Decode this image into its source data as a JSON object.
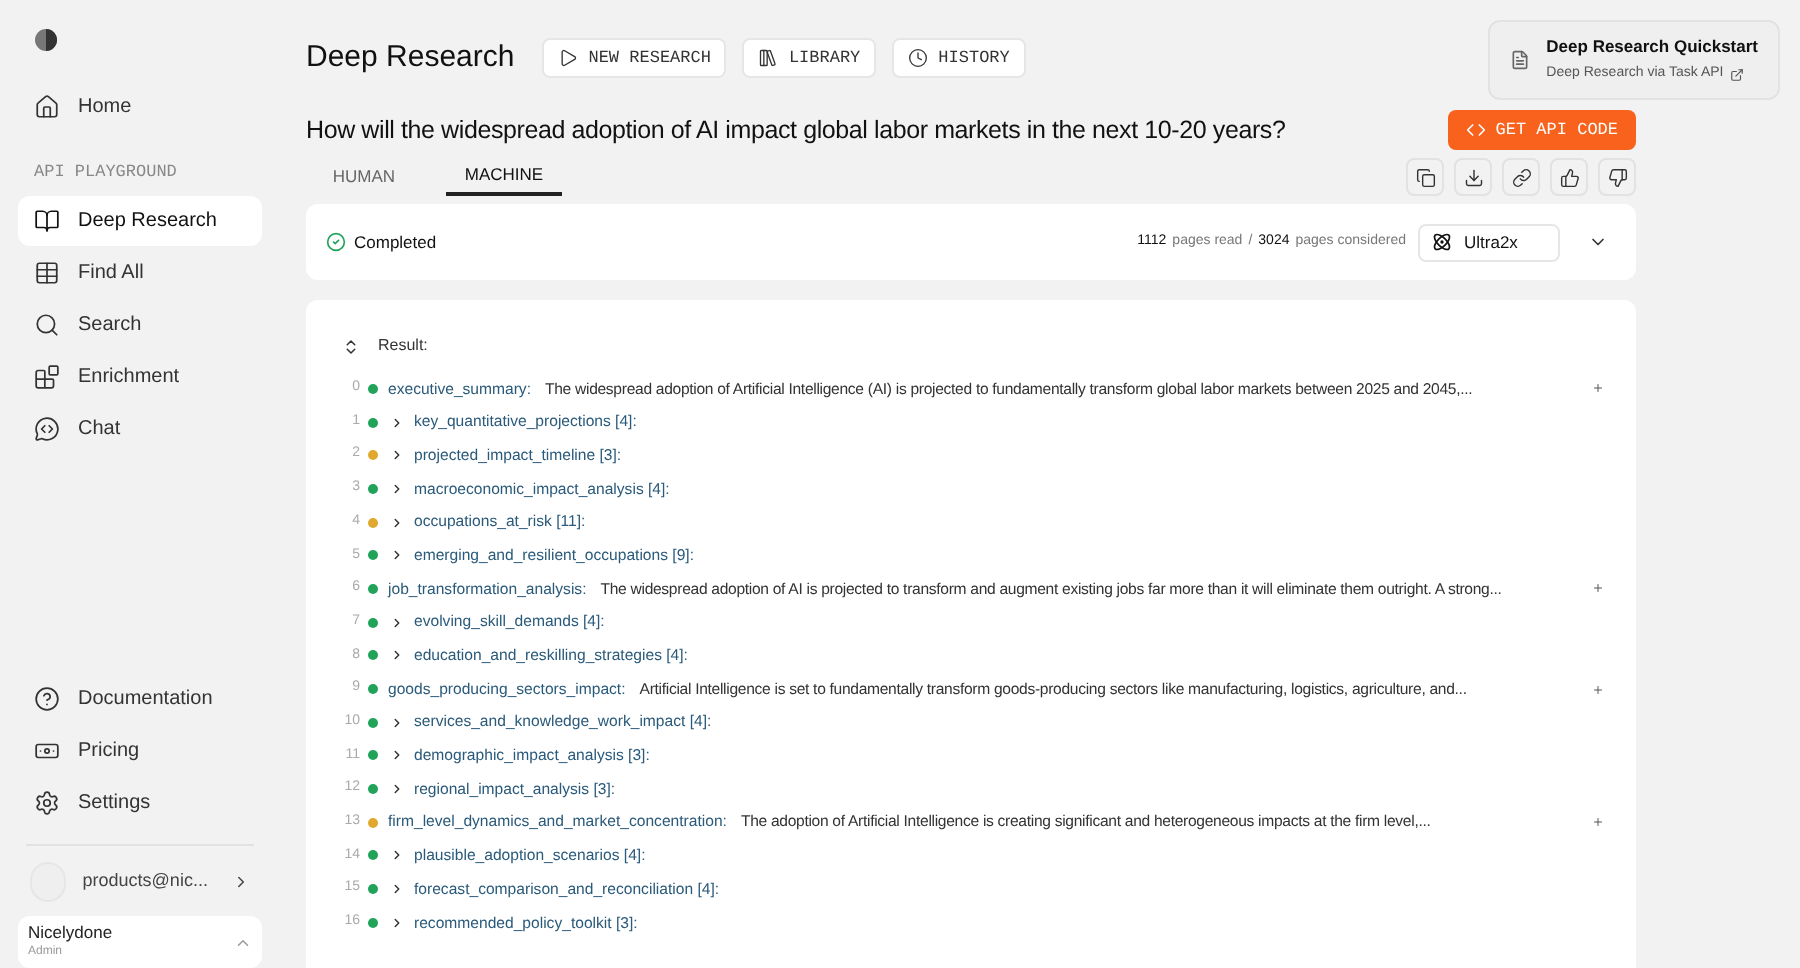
{
  "sidebar": {
    "nav": [
      {
        "label": "Home",
        "kind": "home",
        "selected": false
      }
    ],
    "section_label": "API PLAYGROUND",
    "items": [
      {
        "label": "Deep Research",
        "kind": "book",
        "selected": true
      },
      {
        "label": "Find All",
        "kind": "table",
        "selected": false
      },
      {
        "label": "Search",
        "kind": "search",
        "selected": false
      },
      {
        "label": "Enrichment",
        "kind": "blocks",
        "selected": false
      },
      {
        "label": "Chat",
        "kind": "chat",
        "selected": false
      }
    ],
    "bottom_items": [
      {
        "label": "Documentation",
        "kind": "help"
      },
      {
        "label": "Pricing",
        "kind": "money"
      },
      {
        "label": "Settings",
        "kind": "settings"
      }
    ],
    "user": {
      "email": "products@nic..."
    },
    "org": {
      "name": "Nicelydone",
      "role": "Admin"
    }
  },
  "header": {
    "title": "Deep Research",
    "buttons": [
      {
        "label": "NEW RESEARCH",
        "kind": "play"
      },
      {
        "label": "LIBRARY",
        "kind": "library"
      },
      {
        "label": "HISTORY",
        "kind": "clock"
      }
    ],
    "quickstart": {
      "title": "Deep Research Quickstart",
      "link": "Deep Research via Task API"
    }
  },
  "question": "How will the widespread adoption of AI impact global labor markets in the next 10-20 years?",
  "api_button": "GET API CODE",
  "tabs": [
    {
      "label": "HUMAN",
      "selected": false
    },
    {
      "label": "MACHINE",
      "selected": true
    }
  ],
  "status": {
    "label": "Completed",
    "pages_read": "1112",
    "pages_read_label": "pages read",
    "separator": "/",
    "pages_considered": "3024",
    "pages_considered_label": "pages considered",
    "processor": "Ultra2x"
  },
  "result": {
    "label": "Result:",
    "rows": [
      {
        "index": "0",
        "color": "#22a35a",
        "kind": "field",
        "key": "executive_summary:",
        "text": "The widespread adoption of Artificial Intelligence (AI) is projected to fundamentally transform global labor markets between 2025 and 2045,..."
      },
      {
        "index": "1",
        "color": "#22a35a",
        "kind": "list",
        "key": "key_quantitative_projections [4]:"
      },
      {
        "index": "2",
        "color": "#e0a82e",
        "kind": "list",
        "key": "projected_impact_timeline [3]:"
      },
      {
        "index": "3",
        "color": "#22a35a",
        "kind": "list",
        "key": "macroeconomic_impact_analysis [4]:"
      },
      {
        "index": "4",
        "color": "#e0a82e",
        "kind": "list",
        "key": "occupations_at_risk [11]:"
      },
      {
        "index": "5",
        "color": "#22a35a",
        "kind": "list",
        "key": "emerging_and_resilient_occupations [9]:"
      },
      {
        "index": "6",
        "color": "#22a35a",
        "kind": "field",
        "key": "job_transformation_analysis:",
        "text": "The widespread adoption of AI is projected to transform and augment existing jobs far more than it will eliminate them outright. A strong..."
      },
      {
        "index": "7",
        "color": "#22a35a",
        "kind": "list",
        "key": "evolving_skill_demands [4]:"
      },
      {
        "index": "8",
        "color": "#22a35a",
        "kind": "list",
        "key": "education_and_reskilling_strategies [4]:"
      },
      {
        "index": "9",
        "color": "#22a35a",
        "kind": "field",
        "key": "goods_producing_sectors_impact:",
        "text": "Artificial Intelligence is set to fundamentally transform goods-producing sectors like manufacturing, logistics, agriculture, and..."
      },
      {
        "index": "10",
        "color": "#22a35a",
        "kind": "list",
        "key": "services_and_knowledge_work_impact [4]:"
      },
      {
        "index": "11",
        "color": "#22a35a",
        "kind": "list",
        "key": "demographic_impact_analysis [3]:"
      },
      {
        "index": "12",
        "color": "#22a35a",
        "kind": "list",
        "key": "regional_impact_analysis [3]:"
      },
      {
        "index": "13",
        "color": "#e0a82e",
        "kind": "field",
        "key": "firm_level_dynamics_and_market_concentration:",
        "text": "The adoption of Artificial Intelligence is creating significant and heterogeneous impacts at the firm level,..."
      },
      {
        "index": "14",
        "color": "#22a35a",
        "kind": "list",
        "key": "plausible_adoption_scenarios [4]:"
      },
      {
        "index": "15",
        "color": "#22a35a",
        "kind": "list",
        "key": "forecast_comparison_and_reconciliation [4]:"
      },
      {
        "index": "16",
        "color": "#22a35a",
        "kind": "list",
        "key": "recommended_policy_toolkit [3]:"
      }
    ]
  }
}
